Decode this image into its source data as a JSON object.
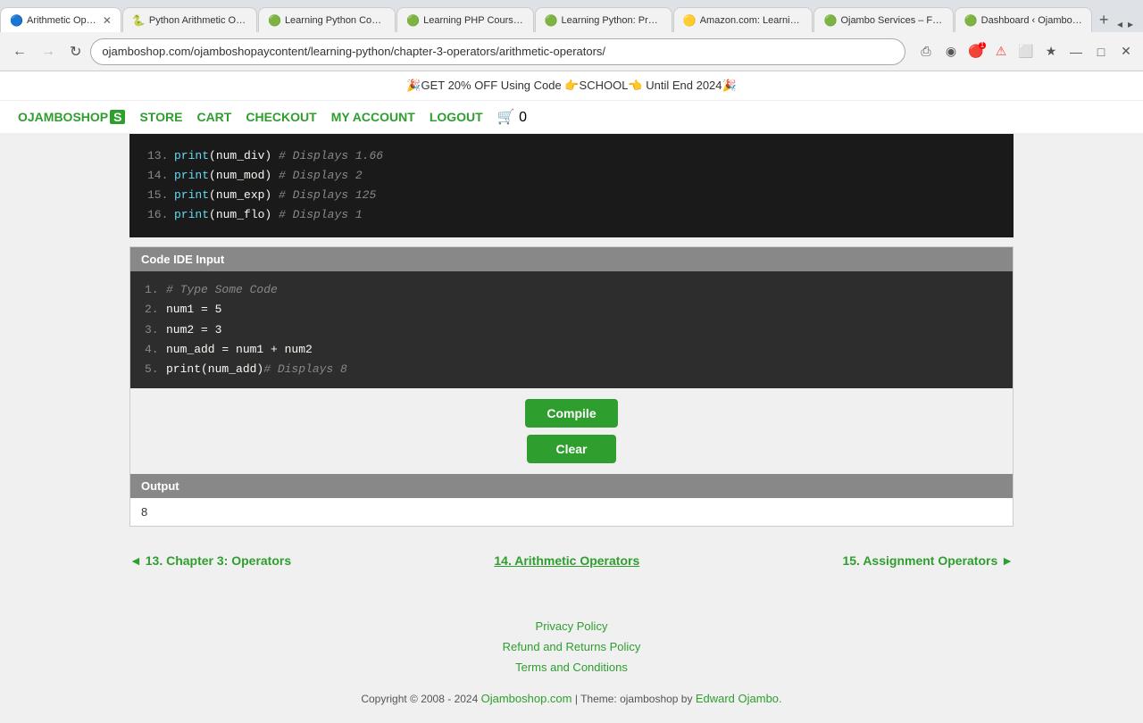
{
  "browser": {
    "tabs": [
      {
        "id": 1,
        "favicon": "🔵",
        "title": "Arithmetic Operators",
        "active": true,
        "closable": true
      },
      {
        "id": 2,
        "favicon": "🐍",
        "title": "Python Arithmetic Operati...",
        "active": false,
        "closable": false
      },
      {
        "id": 3,
        "favicon": "🟢",
        "title": "Learning Python Course - ...",
        "active": false,
        "closable": false
      },
      {
        "id": 4,
        "favicon": "🟢",
        "title": "Learning PHP Course - Oj...",
        "active": false,
        "closable": false
      },
      {
        "id": 5,
        "favicon": "🟢",
        "title": "Learning Python: Program...",
        "active": false,
        "closable": false
      },
      {
        "id": 6,
        "favicon": "🟡",
        "title": "Amazon.com: Learning PH...",
        "active": false,
        "closable": false
      },
      {
        "id": 7,
        "favicon": "🟢",
        "title": "Ojambo Services – For Ind...",
        "active": false,
        "closable": false
      },
      {
        "id": 8,
        "favicon": "🟢",
        "title": "Dashboard ‹ Ojambo — W...",
        "active": false,
        "closable": false
      }
    ],
    "address": "ojamboshop.com/ojamboshopaycontent/learning-python/chapter-3-operators/arithmetic-operators/",
    "nav": {
      "back_disabled": false,
      "forward_disabled": false
    }
  },
  "promo": {
    "text": "🎉GET 20% OFF Using Code 👉SCHOOL👈 Until End 2024🎉"
  },
  "site_nav": {
    "brand_text": "OJAMBOSHOP",
    "brand_s": "S",
    "links": [
      "STORE",
      "CART",
      "CHECKOUT",
      "MY ACCOUNT",
      "LOGOUT"
    ]
  },
  "code_block": {
    "lines": [
      {
        "num": "13.",
        "code": "print(num_div)",
        "comment": "# Displays 1.66"
      },
      {
        "num": "14.",
        "code": "print(num_mod)",
        "comment": "# Displays 2"
      },
      {
        "num": "15.",
        "code": "print(num_exp)",
        "comment": "# Displays 125"
      },
      {
        "num": "16.",
        "code": "print(num_flo)",
        "comment": "# Displays 1"
      }
    ]
  },
  "ide": {
    "header": "Code IDE Input",
    "lines": [
      {
        "num": "1.",
        "code": "# Type Some Code",
        "is_comment": true
      },
      {
        "num": "2.",
        "code": "num1 = 5",
        "is_comment": false
      },
      {
        "num": "3.",
        "code": "num2 = 3",
        "is_comment": false
      },
      {
        "num": "4.",
        "code": "num_add = num1 + num2",
        "is_comment": false
      },
      {
        "num": "5.",
        "code": "print(num_add)",
        "comment": "# Displays 8",
        "is_comment": false
      }
    ],
    "compile_btn": "Compile",
    "clear_btn": "Clear",
    "output_header": "Output",
    "output_value": "8"
  },
  "lesson_nav": {
    "prev_label": "◄ 13. Chapter 3: Operators",
    "current_label": "14. Arithmetic Operators",
    "next_label": "15. Assignment Operators ►"
  },
  "footer": {
    "links": [
      "Privacy Policy",
      "Refund and Returns Policy",
      "Terms and Conditions"
    ],
    "copyright": "Copyright © 2008 - 2024",
    "site_link": "Ojamboshop.com",
    "theme_text": "| Theme: ojamboshop by",
    "author": "Edward Ojambo."
  }
}
